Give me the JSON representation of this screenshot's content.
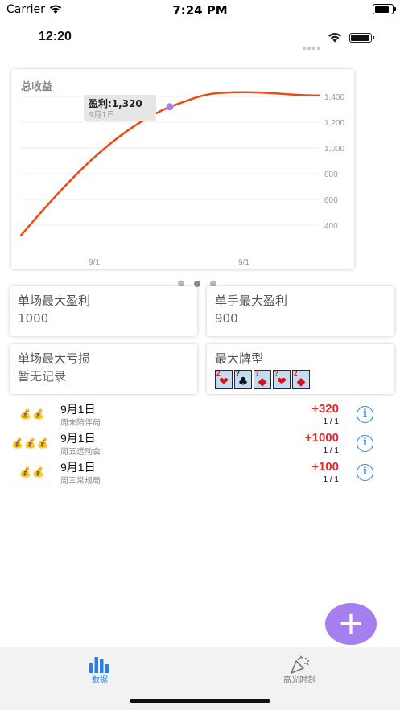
{
  "system_status": {
    "carrier": "Carrier",
    "time": "7:24 PM",
    "battery_level": 0.85
  },
  "inner_status": {
    "time": "12:20",
    "battery_level": 0.95
  },
  "chart": {
    "title": "总收益",
    "tooltip": {
      "label": "盈利:1,320",
      "date": "9月1日"
    },
    "x_tick_labels": [
      "9/1",
      "9/1"
    ],
    "y_tick_labels": [
      "1,400",
      "1,200",
      "1,000",
      "800",
      "600",
      "400"
    ]
  },
  "chart_data": {
    "type": "line",
    "title": "总收益",
    "xlabel": "",
    "ylabel": "",
    "x": [
      "9/1",
      "9/1"
    ],
    "series": [
      {
        "values": [
          320,
          1320,
          1420
        ]
      }
    ],
    "ylim": [
      300,
      1450
    ],
    "y_ticks": [
      400,
      600,
      800,
      1000,
      1200,
      1400
    ],
    "highlight": {
      "value": 1320,
      "label": "盈利:1,320",
      "date": "9月1日"
    },
    "grid": true,
    "colors": {
      "line": "#ea4c12",
      "highlight": "#a57ef0"
    }
  },
  "pager": {
    "count": 3,
    "active": 1
  },
  "stats": {
    "max_win_session": {
      "label": "单场最大盈利",
      "value": "1000"
    },
    "max_win_hand": {
      "label": "单手最大盈利",
      "value": "900"
    },
    "max_loss_session": {
      "label": "单场最大亏损",
      "value": "暂无记录"
    },
    "best_hand": {
      "label": "最大牌型",
      "cards": [
        {
          "rank": "2",
          "suit": "❤",
          "color": "red"
        },
        {
          "rank": "?",
          "suit": "♣",
          "color": "black"
        },
        {
          "rank": "?",
          "suit": "◆",
          "color": "red"
        },
        {
          "rank": "?",
          "suit": "❤",
          "color": "red"
        },
        {
          "rank": "2",
          "suit": "◆",
          "color": "red"
        }
      ]
    }
  },
  "records": [
    {
      "bags": "💰💰",
      "date": "9月1日",
      "name": "周末陪伴局",
      "amount": "+320",
      "count": "1 / 1"
    },
    {
      "bags": "💰💰💰",
      "date": "9月1日",
      "name": "周五运动会",
      "amount": "+1000",
      "count": "1 / 1"
    },
    {
      "bags": "💰💰",
      "date": "9月1日",
      "name": "周三常规局",
      "amount": "+100",
      "count": "1 / 1"
    }
  ],
  "info_glyph": "i",
  "fab": {
    "glyph": "+",
    "color": "#a57ef0"
  },
  "tabs": [
    {
      "label": "数据",
      "icon": "bar-chart-icon",
      "active": true,
      "color": "#2a7ee6"
    },
    {
      "label": "高光时刻",
      "icon": "party-popper-icon",
      "active": false,
      "color": "#777777"
    }
  ]
}
